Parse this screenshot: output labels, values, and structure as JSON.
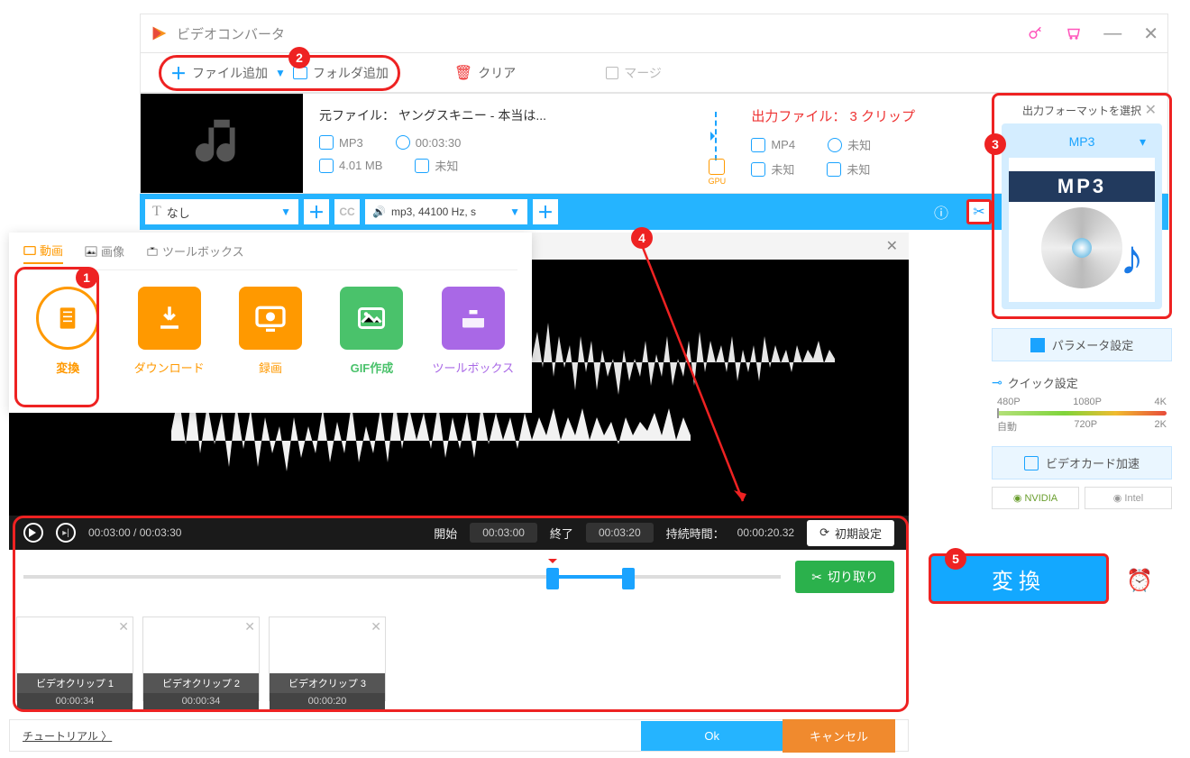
{
  "titlebar": {
    "app_name": "ビデオコンバータ"
  },
  "toolbar": {
    "add_file": "ファイル追加",
    "add_folder": "フォルダ追加",
    "clear": "クリア",
    "merge": "マージ"
  },
  "filerow": {
    "source_label": "元ファイル： ヤングスキニー - 本当は...",
    "src_format": "MP3",
    "src_duration": "00:03:30",
    "src_size": "4.01 MB",
    "src_resolution": "未知",
    "gpu": "GPU",
    "out_label": "出力ファイル： 3 クリップ",
    "out_format": "MP4",
    "out_duration": "未知",
    "out_size": "未知",
    "out_resolution": "未知"
  },
  "actionbar": {
    "subtitle_none": "なし",
    "audio_info": "mp3, 44100 Hz, s"
  },
  "modetabs": {
    "tab_video": "動画",
    "tab_image": "画像",
    "tab_tools": "ツールボックス",
    "convert": "変換",
    "download": "ダウンロード",
    "record": "録画",
    "gif": "GIF作成",
    "toolbox": "ツールボックス"
  },
  "playbar": {
    "current": "00:03:00",
    "total": "00:03:30",
    "start_label": "開始",
    "start_time": "00:03:00",
    "end_label": "終了",
    "end_time": "00:03:20",
    "duration_label": "持続時間：",
    "duration": "00:00:20.32",
    "reset": "初期設定"
  },
  "trim": {
    "cut": "切り取り"
  },
  "clips": [
    {
      "name": "ビデオクリップ 1",
      "time": "00:00:34"
    },
    {
      "name": "ビデオクリップ 2",
      "time": "00:00:34"
    },
    {
      "name": "ビデオクリップ 3",
      "time": "00:00:20"
    }
  ],
  "bottom": {
    "tutorial": "チュートリアル ",
    "ok": "Ok",
    "cancel": "キャンセル"
  },
  "right": {
    "format_title": "出力フォーマットを選択",
    "format_selected": "MP3",
    "format_badge": "MP3",
    "param": "パラメータ設定",
    "quick_title": "クイック設定",
    "res_480": "480P",
    "res_1080": "1080P",
    "res_4k": "4K",
    "res_auto": "自動",
    "res_720": "720P",
    "res_2k": "2K",
    "gpu_accel": "ビデオカード加速",
    "nvidia": "NVIDIA",
    "intel": "Intel",
    "convert_btn": "変換"
  }
}
